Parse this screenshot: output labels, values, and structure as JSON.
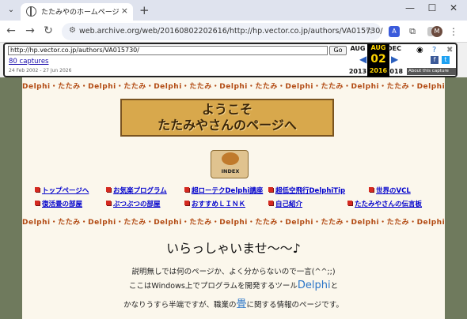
{
  "browser": {
    "tab_title": "たたみやのホームページ",
    "close_icon": "×",
    "new_tab": "+",
    "minimize": "—",
    "maximize": "☐",
    "close_window": "✕",
    "url": "web.archive.org/web/20160802202616/http://hp.vector.co.jp/authors/VA015730/"
  },
  "wayback": {
    "url_input": "http://hp.vector.co.jp/authors/VA015730/",
    "go_label": "Go",
    "captures": "80 captures",
    "range": "24 Feb 2002 - 27 Jun 2026",
    "prev": {
      "month": "AUG",
      "year": "2013"
    },
    "current": {
      "month": "AUG",
      "day": "02",
      "year": "2016"
    },
    "next": {
      "month": "DEC",
      "year": "2018"
    },
    "about": "About this capture"
  },
  "page": {
    "stripe_text": "Delphi・たたみ・Delphi・たたみ・Delphi・たたみ・Delphi・たたみ・Delphi・たたみ・Delphi・たたみ・Delphi・たたみ・Delphi・たたみ・Delphi・",
    "welcome_line1": "ようこそ",
    "welcome_line2": "たたみやさんのページへ",
    "index_label": "INDEX",
    "links_row1": [
      "トップページへ",
      "お気楽プログラム",
      "超ローテクDelphi講座",
      "超低空飛行DelphiTip",
      "世界のVCL"
    ],
    "links_row2": [
      "復活畳の部屋",
      "ぶつぶつの部屋",
      "おすすめＬＩＮＫ",
      "自己紹介",
      "たたみやさんの伝言板"
    ],
    "greeting": "いらっしゃいませ〜〜♪",
    "para1": "説明無しでは何のページか、よく分からないので一言(^^;;)",
    "para2_pre": "ここはWindows上でプログラムを開発するツール",
    "para2_hl": "Delphi",
    "para2_post": "と",
    "para3_pre": "かなりうすら半端ですが、職業の",
    "para3_hl": "畳",
    "para3_post": "に関する情報のページです。"
  }
}
